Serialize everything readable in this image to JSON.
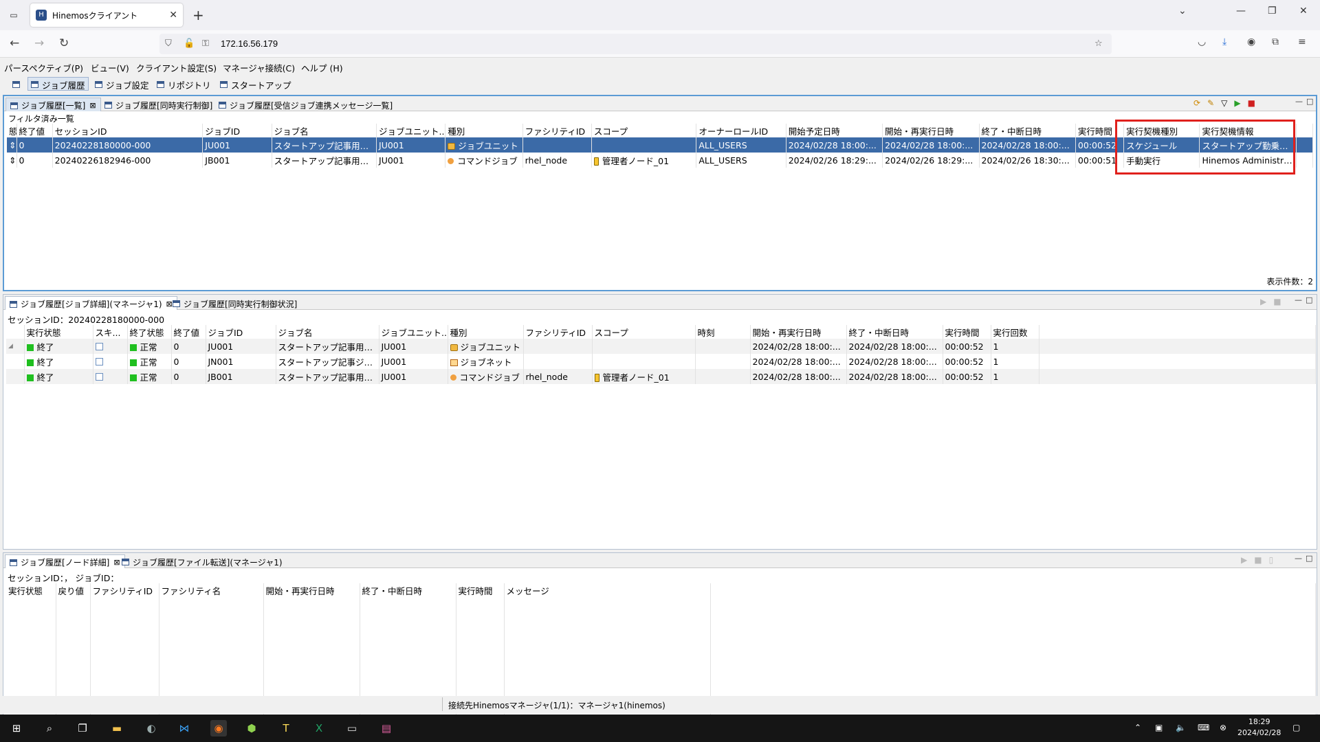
{
  "browser": {
    "tab_title": "Hinemosクライアント",
    "url": "172.16.56.179"
  },
  "menu": [
    "パースペクティブ(P)",
    "ビュー(V)",
    "クライアント設定(S)",
    "マネージャ接続(C)",
    "ヘルプ (H)"
  ],
  "perspectives": [
    "ジョブ履歴",
    "ジョブ設定",
    "リポジトリ",
    "スタートアップ"
  ],
  "top_panel": {
    "tabs": [
      "ジョブ履歴[一覧]",
      "ジョブ履歴[同時実行制御]",
      "ジョブ履歴[受信ジョブ連携メッセージ一覧]"
    ],
    "subtitle": "フィルタ済み一覧",
    "columns": [
      "態",
      "終了値",
      "セッションID",
      "ジョブID",
      "ジョブ名",
      "ジョブユニット...",
      "種別",
      "ファシリティID",
      "スコープ",
      "オーナーロールID",
      "開始予定日時",
      "開始・再実行日時",
      "終了・中断日時",
      "実行時間",
      "実行契機種別",
      "実行契機情報"
    ],
    "rows": [
      {
        "state": "",
        "end_value": "0",
        "session": "20240228180000-000",
        "job_id": "JU001",
        "job_name": "スタートアップ記事用ジ...",
        "unit": "JU001",
        "type": "ジョブユニット",
        "facility": "",
        "scope": "",
        "owner": "ALL_USERS",
        "sched": "2024/02/28 18:00:...",
        "start": "2024/02/28 18:00:...",
        "end": "2024/02/28 18:00:...",
        "time": "00:00:52",
        "trig_type": "スケジュール",
        "trig_info": "スタートアップ勤乗実..."
      },
      {
        "state": "",
        "end_value": "0",
        "session": "20240226182946-000",
        "job_id": "JB001",
        "job_name": "スタートアップ記事用ジ...",
        "unit": "JU001",
        "type": "コマンドジョブ",
        "facility": "rhel_node",
        "scope": "管理者ノード_01",
        "owner": "ALL_USERS",
        "sched": "2024/02/26 18:29:...",
        "start": "2024/02/26 18:29:...",
        "end": "2024/02/26 18:30:...",
        "time": "00:00:51",
        "trig_type": "手動実行",
        "trig_info": "Hinemos Administra..."
      }
    ],
    "count_label": "表示件数：2"
  },
  "mid_panel": {
    "tabs": [
      "ジョブ履歴[ジョブ詳細](マネージャ1)",
      "ジョブ履歴[同時実行制御状況]"
    ],
    "subtitle": "セッションID：20240228180000-000",
    "columns": [
      "",
      "実行状態",
      "スキ...",
      "終了状態",
      "終了値",
      "ジョブID",
      "ジョブ名",
      "ジョブユニット...",
      "種別",
      "ファシリティID",
      "スコープ",
      "時刻",
      "開始・再実行日時",
      "終了・中断日時",
      "実行時間",
      "実行回数"
    ],
    "rows": [
      {
        "run": "終了",
        "endstate": "正常",
        "end_value": "0",
        "job_id": "JU001",
        "job_name": "スタートアップ記事用ジ...",
        "unit": "JU001",
        "type": "ジョブユニット",
        "facility": "",
        "scope": "",
        "start": "2024/02/28 18:00:...",
        "end": "2024/02/28 18:00:...",
        "time": "00:00:52",
        "count": "1"
      },
      {
        "run": "終了",
        "endstate": "正常",
        "end_value": "0",
        "job_id": "JN001",
        "job_name": "スタートアップ記事ジョ...",
        "unit": "JU001",
        "type": "ジョブネット",
        "facility": "",
        "scope": "",
        "start": "2024/02/28 18:00:...",
        "end": "2024/02/28 18:00:...",
        "time": "00:00:52",
        "count": "1"
      },
      {
        "run": "終了",
        "endstate": "正常",
        "end_value": "0",
        "job_id": "JB001",
        "job_name": "スタートアップ記事用ジ...",
        "unit": "JU001",
        "type": "コマンドジョブ",
        "facility": "rhel_node",
        "scope": "管理者ノード_01",
        "start": "2024/02/28 18:00:...",
        "end": "2024/02/28 18:00:...",
        "time": "00:00:52",
        "count": "1"
      }
    ]
  },
  "bottom_panel": {
    "tabs": [
      "ジョブ履歴[ノード詳細]",
      "ジョブ履歴[ファイル転送](マネージャ1)"
    ],
    "subtitle": "セッションID：，  ジョブID：",
    "columns": [
      "実行状態",
      "戻り値",
      "ファシリティID",
      "ファシリティ名",
      "開始・再実行日時",
      "終了・中断日時",
      "実行時間",
      "メッセージ"
    ]
  },
  "status": "接続先Hinemosマネージャ(1/1)：マネージャ1(hinemos)",
  "clock": {
    "time": "18:29",
    "date": "2024/02/28"
  },
  "colors": {
    "selected_row": "#3b6aa7",
    "highlight_box": "#e0201c",
    "status_green": "#1fbf1f"
  }
}
